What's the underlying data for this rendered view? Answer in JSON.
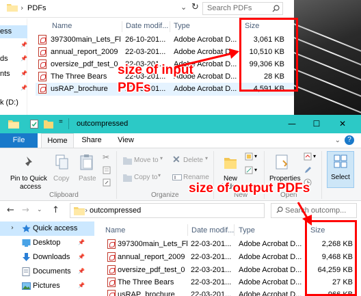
{
  "bg_window": {
    "path": "PDFs",
    "search_placeholder": "Search PDFs",
    "nav_items": [
      {
        "label": "ess",
        "pinned": false,
        "selected": true
      },
      {
        "label": "",
        "pinned": true
      },
      {
        "label": "ds",
        "pinned": true
      },
      {
        "label": "nts",
        "pinned": true
      },
      {
        "label": "",
        "pinned": true
      },
      {
        "label": "k (D:)",
        "pinned": false
      },
      {
        "label": "",
        "pinned": false
      }
    ],
    "columns": {
      "name": "Name",
      "date": "Date modif...",
      "type": "Type",
      "size": "Size"
    },
    "files": [
      {
        "name": "397300main_Lets_Fl...",
        "date": "26-10-201...",
        "type": "Adobe Acrobat D...",
        "size": "3,061 KB"
      },
      {
        "name": "annual_report_2009",
        "date": "22-03-201...",
        "type": "Adobe Acrobat D...",
        "size": "10,510 KB"
      },
      {
        "name": "oversize_pdf_test_0",
        "date": "22-03-201...",
        "type": "Adobe Acrobat D...",
        "size": "99,306 KB"
      },
      {
        "name": "The Three Bears",
        "date": "22-03-201...",
        "type": "Adobe Acrobat D...",
        "size": "28 KB"
      },
      {
        "name": "usRAP_brochure",
        "date": "22-03-201...",
        "type": "Adobe Acrobat D...",
        "size": "4,591 KB"
      }
    ]
  },
  "front_window": {
    "title": "outcompressed",
    "tabs": {
      "file": "File",
      "home": "Home",
      "share": "Share",
      "view": "View"
    },
    "ribbon": {
      "pin_quick_access": "Pin to Quick",
      "pin_quick_access_2": "access",
      "copy": "Copy",
      "paste": "Paste",
      "clipboard_group": "Clipboard",
      "move_to": "Move to",
      "copy_to": "Copy to",
      "delete": "Delete",
      "rename": "Rename",
      "organize_group": "Organize",
      "new_folder": "New",
      "new_folder_2": "folder",
      "new_group": "New",
      "properties": "Properties",
      "open_group": "Open",
      "select": "Select",
      "help": "?"
    },
    "path": "outcompressed",
    "search_placeholder": "Search outcomp...",
    "nav_items": [
      {
        "label": "Quick access",
        "icon": "star-icon",
        "selected": true
      },
      {
        "label": "Desktop",
        "icon": "desktop-icon"
      },
      {
        "label": "Downloads",
        "icon": "download-icon"
      },
      {
        "label": "Documents",
        "icon": "documents-icon"
      },
      {
        "label": "Pictures",
        "icon": "pictures-icon"
      }
    ],
    "columns": {
      "name": "Name",
      "date": "Date modif...",
      "type": "Type",
      "size": "Size"
    },
    "files": [
      {
        "name": "397300main_Lets_Fl...",
        "date": "22-03-201...",
        "type": "Adobe Acrobat D...",
        "size": "2,268 KB"
      },
      {
        "name": "annual_report_2009",
        "date": "22-03-201...",
        "type": "Adobe Acrobat D...",
        "size": "9,468 KB"
      },
      {
        "name": "oversize_pdf_test_0",
        "date": "22-03-201...",
        "type": "Adobe Acrobat D...",
        "size": "64,259 KB"
      },
      {
        "name": "The Three Bears",
        "date": "22-03-201...",
        "type": "Adobe Acrobat D...",
        "size": "27 KB"
      },
      {
        "name": "usRAP_brochure",
        "date": "22-03-201...",
        "type": "Adobe Acrobat D...",
        "size": "966 KB"
      }
    ]
  },
  "annotations": {
    "input_label_1": "size of input",
    "input_label_2": "PDFs",
    "output_label": "size of output PDFs"
  },
  "colors": {
    "titlebar": "#2cc9c6",
    "file_tab": "#1979ca",
    "annotation": "#ff0000",
    "selection": "#cce8ff"
  }
}
